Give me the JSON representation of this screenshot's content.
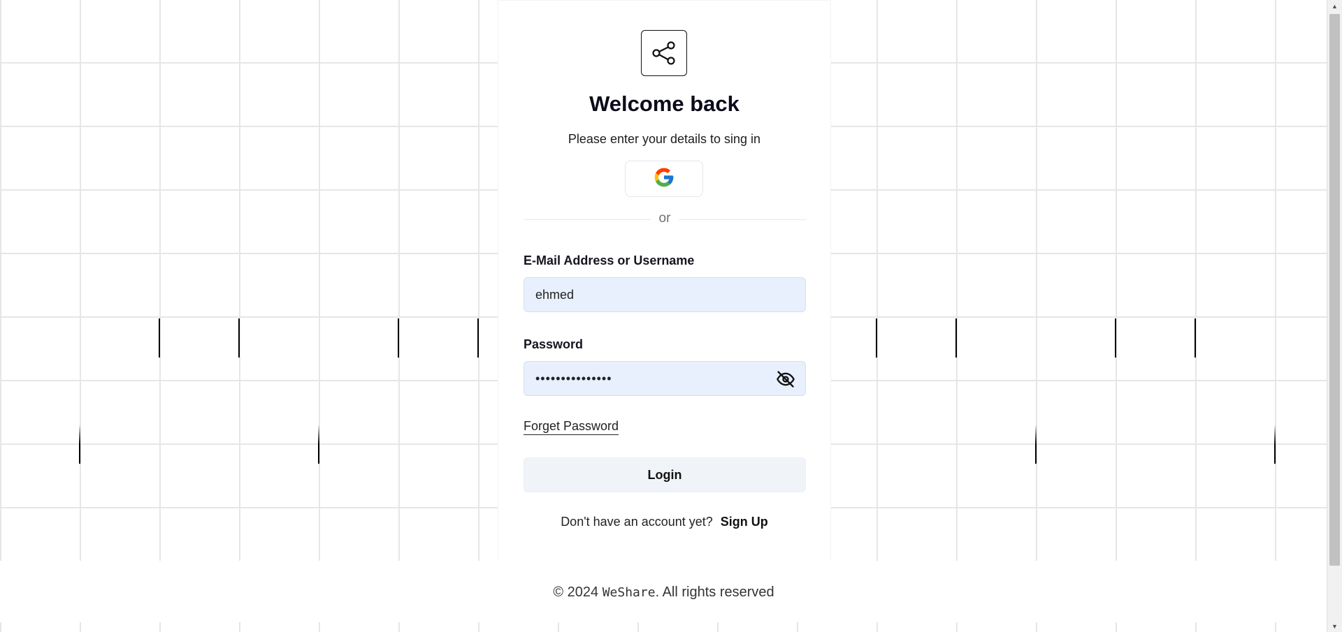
{
  "card": {
    "logo_icon": "share-nodes-icon",
    "title": "Welcome back",
    "subtitle": "Please enter your details to sing in",
    "google_icon": "google-icon",
    "divider_text": "or",
    "email": {
      "label": "E-Mail Address or Username",
      "value": "ehmed"
    },
    "password": {
      "label": "Password",
      "masked_value": "•••••••••••••••",
      "toggle_icon": "eye-off-icon"
    },
    "forget_password": "Forget Password",
    "login_button": "Login",
    "signup_prompt": "Don't have an account yet?",
    "signup_link": "Sign Up"
  },
  "footer": {
    "copyright_prefix": "© 2024",
    "brand": "WeShare",
    "copyright_suffix": ". All rights reserved"
  },
  "colors": {
    "input_bg": "#e8f0fe",
    "button_bg": "#f0f3f8",
    "grid_line": "#e6e6e6"
  }
}
